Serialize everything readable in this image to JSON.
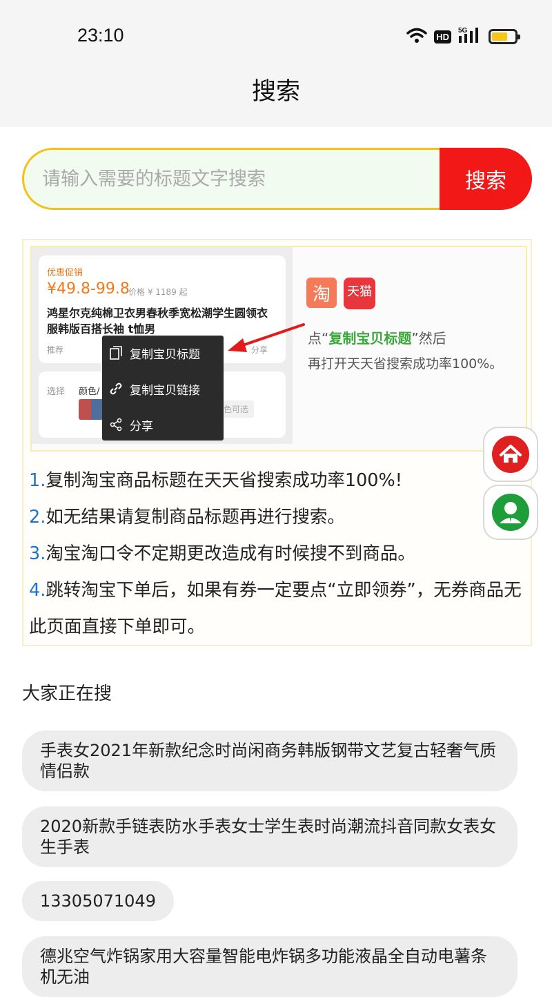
{
  "status_bar": {
    "time": "23:10",
    "hd_label": "HD",
    "network_label": "5G",
    "battery_level": 0.7
  },
  "header": {
    "title": "搜索"
  },
  "search": {
    "placeholder": "请输入需要的标题文字搜索",
    "value": "",
    "button_label": "搜索"
  },
  "guide": {
    "product": {
      "promo_tag": "优惠促销",
      "price": "¥49.8-99.8",
      "orig_price": "价格 ¥ 1189 起",
      "title": "鸿星尔克纯棉卫衣男春秋季宽松潮学生圆领衣服韩版百搭长袖 t恤男",
      "recommend": "推荐",
      "share": "分享",
      "select_label": "选择",
      "color_label": "颜色/",
      "more_colors": "色可选"
    },
    "menu": {
      "copy_title": "复制宝贝标题",
      "copy_link": "复制宝贝链接",
      "share": "分享"
    },
    "logos": {
      "taobao": "淘",
      "tmall": "天猫"
    },
    "tip_prefix": "点“",
    "tip_highlight": "复制宝贝标题",
    "tip_suffix": "”然后",
    "tip_line2": "再打开天天省搜索成功率100%。"
  },
  "instructions": [
    {
      "num": "1.",
      "text": "复制淘宝商品标题在天天省搜索成功率100%!"
    },
    {
      "num": "2.",
      "text": "如无结果请复制商品标题再进行搜索。"
    },
    {
      "num": "3.",
      "text": "淘宝淘口令不定期更改造成有时候搜不到商品。"
    },
    {
      "num": "4.",
      "text": "跳转淘宝下单后，如果有券一定要点“立即领券”，无券商品无此页面直接下单即可。"
    }
  ],
  "hot_searches": {
    "title": "大家正在搜",
    "items": [
      "手表女2021年新款纪念时尚闲商务韩版钢带文艺复古轻奢气质情侣款",
      "2020新款手链表防水手表女士学生表时尚潮流抖音同款女表女生手表",
      "13305071049",
      "德兆空气炸锅家用大容量智能电炸锅多功能液晶全自动电薯条机无油"
    ]
  },
  "colors": {
    "accent_red": "#f21818",
    "input_border": "#f2c21b",
    "link_blue": "#1e73c8",
    "highlight_green": "#3aa83a"
  },
  "icons": {
    "home": "home-icon",
    "user": "user-icon",
    "wifi": "wifi-icon",
    "signal": "signal-icon",
    "battery": "battery-icon"
  }
}
